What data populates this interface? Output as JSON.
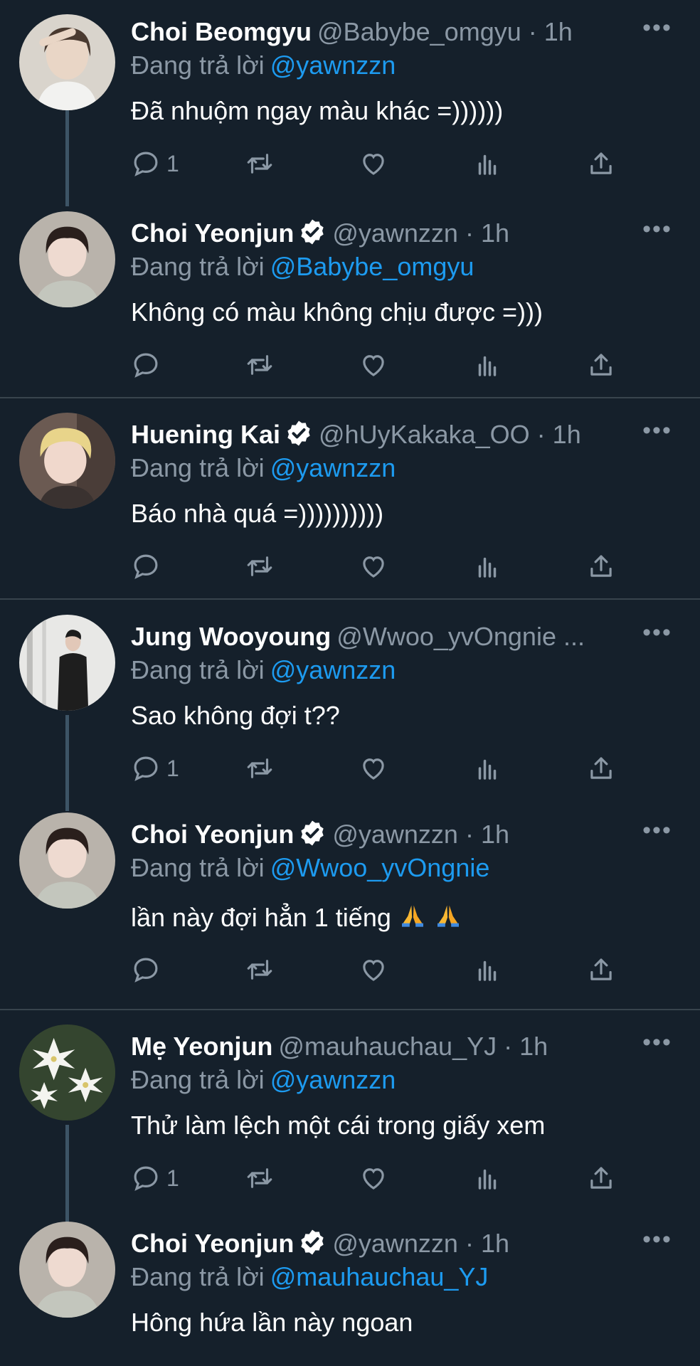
{
  "reply_prefix": "Đang trả lời",
  "colors": {
    "background": "#15202b",
    "link": "#1d9bf0",
    "secondary": "#8b98a5",
    "divider": "#38444d"
  },
  "tweets": [
    {
      "name": "Choi Beomgyu",
      "verified": false,
      "handle": "@Babybe_omgyu · 1h",
      "reply_to": "@yawnzzn",
      "text": "Đã nhuộm ngay màu khác =))))))",
      "reply_count": "1"
    },
    {
      "name": "Choi Yeonjun",
      "verified": true,
      "handle": "@yawnzzn · 1h",
      "reply_to": "@Babybe_omgyu",
      "text": "Không có màu không chịu được =)))",
      "reply_count": ""
    },
    {
      "name": "Huening Kai",
      "verified": true,
      "handle": "@hUyKakaka_OO · 1h",
      "reply_to": "@yawnzzn",
      "text": "Báo nhà quá =))))))))))",
      "reply_count": ""
    },
    {
      "name": "Jung Wooyoung",
      "verified": false,
      "handle": "@Wwoo_yvOngnie ...",
      "reply_to": "@yawnzzn",
      "text": "Sao không đợi t??",
      "reply_count": "1"
    },
    {
      "name": "Choi Yeonjun",
      "verified": true,
      "handle": "@yawnzzn · 1h",
      "reply_to": "@Wwoo_yvOngnie",
      "text": "lần này đợi hẳn 1 tiếng",
      "emoji": "folded-hands",
      "reply_count": ""
    },
    {
      "name": "Mẹ Yeonjun",
      "verified": false,
      "handle": "@mauhauchau_YJ · 1h",
      "reply_to": "@yawnzzn",
      "text": "Thử làm lệch một cái trong giấy xem",
      "reply_count": "1"
    },
    {
      "name": "Choi Yeonjun",
      "verified": true,
      "handle": "@yawnzzn · 1h",
      "reply_to": "@mauhauchau_YJ",
      "text": "Hông hứa lần này ngoan",
      "reply_count": ""
    }
  ]
}
